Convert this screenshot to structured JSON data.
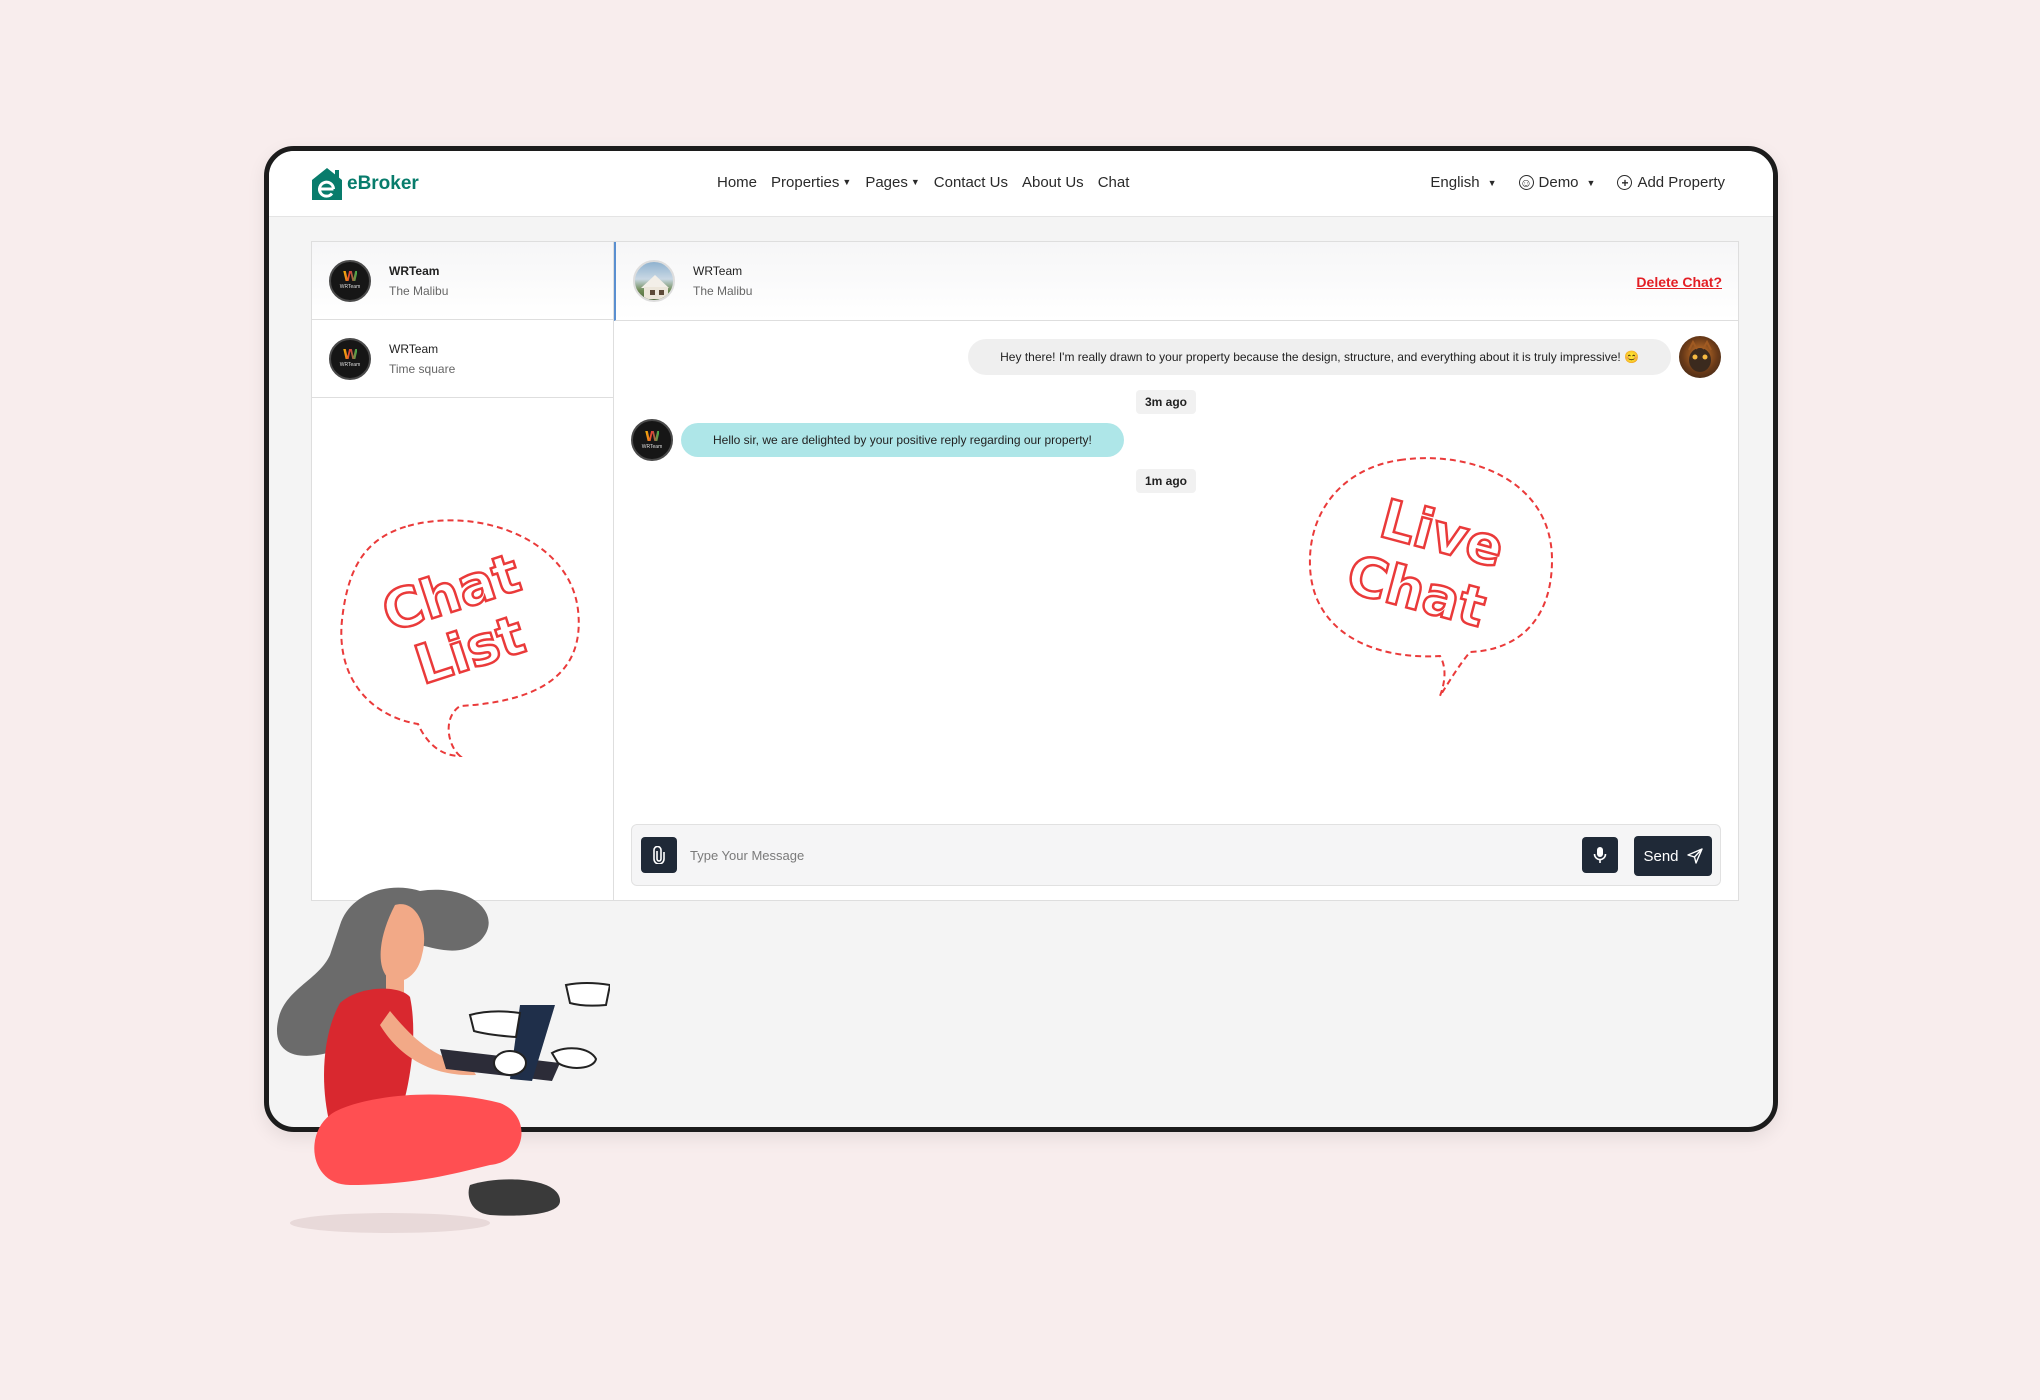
{
  "navbar": {
    "logo_text": "eBroker",
    "links": [
      {
        "label": "Home"
      },
      {
        "label": "Properties",
        "dropdown": true
      },
      {
        "label": "Pages",
        "dropdown": true
      },
      {
        "label": "Contact Us"
      },
      {
        "label": "About Us"
      },
      {
        "label": "Chat"
      }
    ],
    "language": "English",
    "user": "Demo",
    "add_property": "Add Property"
  },
  "conversations": [
    {
      "name": "WRTeam",
      "subtitle": "The Malibu",
      "active": true
    },
    {
      "name": "WRTeam",
      "subtitle": "Time square",
      "active": false
    }
  ],
  "chat_header": {
    "name": "WRTeam",
    "subtitle": "The Malibu",
    "delete_label": "Delete Chat?"
  },
  "messages": [
    {
      "direction": "outgoing",
      "text": "Hey there! I'm really drawn to your property because the design, structure, and everything about it is truly impressive! 😊",
      "time": "3m ago"
    },
    {
      "direction": "incoming",
      "text": "Hello sir, we are delighted by your positive reply regarding our property!",
      "time": "1m ago"
    }
  ],
  "composer": {
    "placeholder": "Type Your Message",
    "send_label": "Send"
  },
  "annotations": {
    "chat_list": [
      "Chat",
      "List"
    ],
    "live_chat": [
      "Live",
      "Chat"
    ]
  },
  "colors": {
    "brand": "#087c6c",
    "delete": "#e31e24",
    "incoming_bubble": "#aee6e8",
    "dark_button": "#1f2937",
    "annotation": "#ea3a3a",
    "background": "#f8eded"
  },
  "icons": [
    "house-logo-icon",
    "caret-down-icon",
    "smile-icon",
    "plus-circle-icon",
    "paperclip-icon",
    "microphone-icon",
    "send-icon"
  ]
}
